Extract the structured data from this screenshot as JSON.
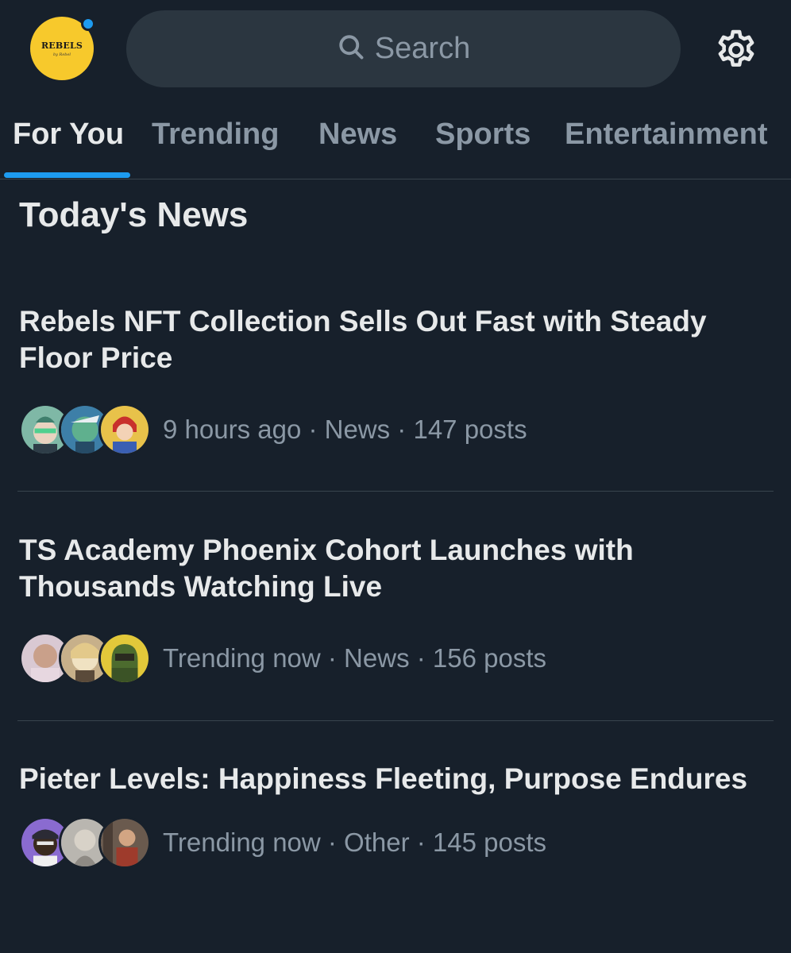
{
  "header": {
    "logo_text": "REBELS",
    "logo_subtext": "by Rebel",
    "search_placeholder": "Search"
  },
  "tabs": [
    {
      "label": "For You",
      "active": true
    },
    {
      "label": "Trending",
      "active": false
    },
    {
      "label": "News",
      "active": false
    },
    {
      "label": "Sports",
      "active": false
    },
    {
      "label": "Entertainment",
      "active": false
    }
  ],
  "section": {
    "title": "Today's News"
  },
  "articles": [
    {
      "title": "Rebels NFT Collection Sells Out Fast with Steady Floor Price",
      "meta": "9 hours ago · News · 147 posts"
    },
    {
      "title": "TS Academy Phoenix Cohort Launches with Thousands Watching Live",
      "meta": "Trending now · News · 156 posts"
    },
    {
      "title": "Pieter Levels: Happiness Fleeting, Purpose Endures",
      "meta": "Trending now · Other · 145 posts"
    }
  ],
  "colors": {
    "background": "#17202b",
    "accent": "#1d9bf0",
    "muted_text": "#8b98a5",
    "primary_text": "#e7e9ea",
    "search_bg": "#2b3640",
    "logo_bg": "#f7c92c"
  },
  "icons": {
    "search": "search-icon",
    "settings": "gear-icon",
    "notification_dot": "notification-dot-icon"
  }
}
